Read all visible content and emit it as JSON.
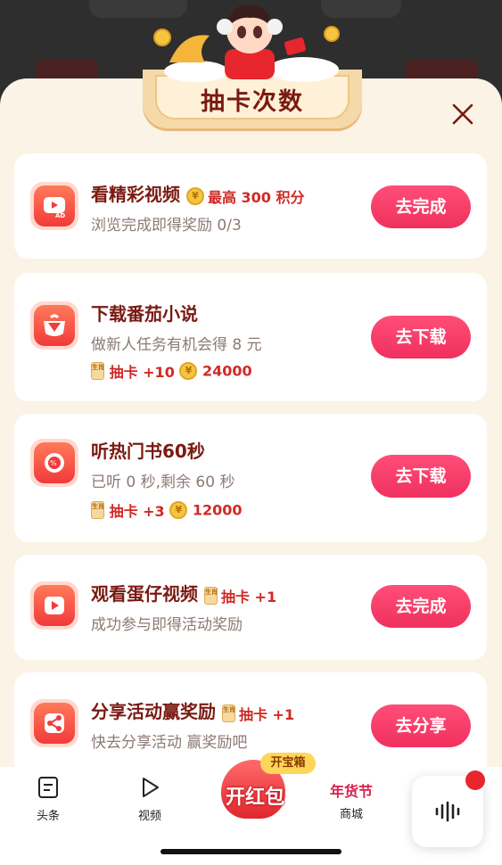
{
  "dialog": {
    "title": "抽卡次数"
  },
  "tasks": [
    {
      "title": "看精彩视频",
      "inline_reward": "最高 300 积分",
      "subtitle": "浏览完成即得奖励 0/3",
      "button": "去完成",
      "icon": "ad-video-icon"
    },
    {
      "title": "下载番茄小说",
      "subtitle": "做新人任务有机会得 8 元",
      "reward_cards": "抽卡 +10",
      "reward_points": "24000",
      "button": "去下载",
      "icon": "tomato-novel-icon"
    },
    {
      "title": "听热门书60秒",
      "subtitle": "已听 0 秒,剩余 60 秒",
      "reward_cards": "抽卡 +3",
      "reward_points": "12000",
      "button": "去下载",
      "icon": "tomato-listen-icon"
    },
    {
      "title": "观看蛋仔视频",
      "inline_reward": "抽卡 +1",
      "subtitle": "成功参与即得活动奖励",
      "button": "去完成",
      "icon": "play-video-icon"
    },
    {
      "title": "分享活动赢奖励",
      "inline_reward": "抽卡 +1",
      "subtitle": "快去分享活动 赢奖励吧",
      "button": "去分享",
      "icon": "share-icon"
    }
  ],
  "coin_glyph": "¥",
  "card_glyph": "生肖",
  "tabbar": {
    "headlines": "头条",
    "video": "视频",
    "center_main": "开红包",
    "center_badge": "开宝箱",
    "mall_banner": "年货节",
    "mall": "商城"
  },
  "colors": {
    "accent": "#f0305e",
    "title": "#7a1a12",
    "reward": "#d02a26",
    "sheet": "#fbf3e6"
  }
}
